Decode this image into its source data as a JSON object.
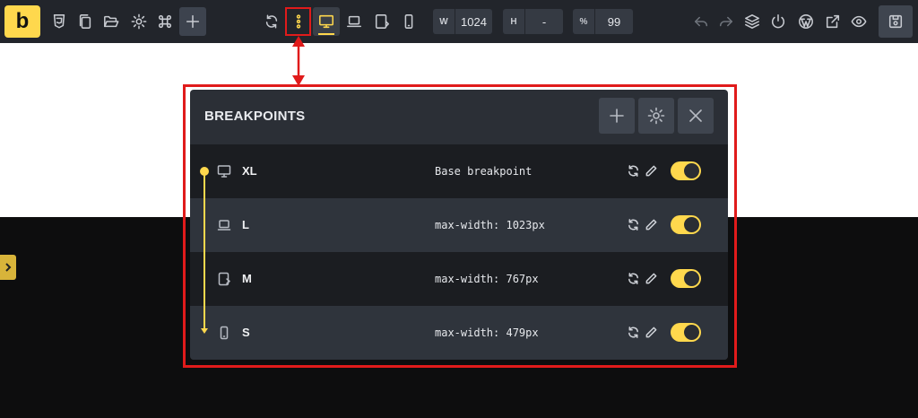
{
  "toolbar": {
    "logo_letter": "b",
    "icons": [
      "html5-icon",
      "pages-icon",
      "folder-icon",
      "settings-icon",
      "command-icon",
      "add-icon"
    ],
    "center_icons": [
      "refresh-icon",
      "breakpoints-menu-icon",
      "desktop-icon",
      "laptop-icon",
      "tablet-icon",
      "mobile-icon"
    ],
    "width_field": {
      "label": "W",
      "value": "1024"
    },
    "height_field": {
      "label": "H",
      "value": "-"
    },
    "zoom_field": {
      "label": "%",
      "value": "99"
    },
    "right_icons": [
      "undo-icon",
      "redo-icon",
      "layers-icon",
      "power-icon",
      "wordpress-icon",
      "external-link-icon",
      "preview-icon",
      "save-icon"
    ]
  },
  "panel": {
    "title": "BREAKPOINTS",
    "header_buttons": [
      "add-icon",
      "settings-icon",
      "close-icon"
    ],
    "rows": [
      {
        "name": "XL",
        "description": "Base breakpoint",
        "device": "desktop",
        "enabled": true
      },
      {
        "name": "L",
        "description": "max-width: 1023px",
        "device": "laptop",
        "enabled": true
      },
      {
        "name": "M",
        "description": "max-width: 767px",
        "device": "tablet",
        "enabled": true
      },
      {
        "name": "S",
        "description": "max-width: 479px",
        "device": "mobile",
        "enabled": true
      }
    ]
  },
  "colors": {
    "accent": "#ffd84d",
    "annotation": "#e01b1b",
    "toolbar_bg": "#22252b",
    "panel_bg": "#2b2f36"
  }
}
